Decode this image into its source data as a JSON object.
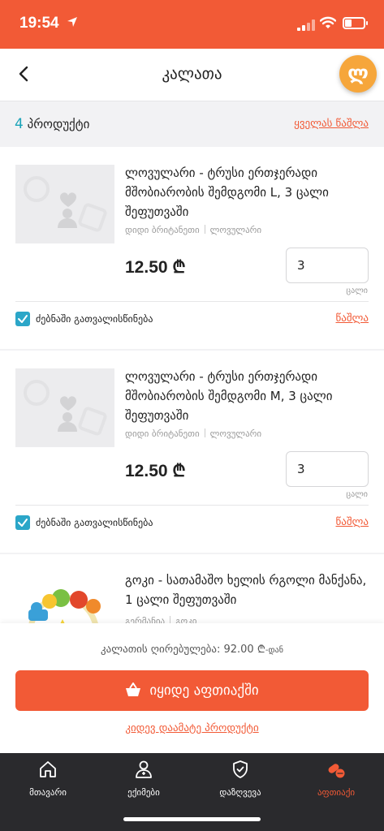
{
  "status_bar": {
    "time": "19:54"
  },
  "header": {
    "title": "კალათა",
    "fab_symbol": "ლ"
  },
  "cart": {
    "count_number": "4",
    "count_label": "პროდუქტი",
    "delete_all": "ყველას წაშლა"
  },
  "products": [
    {
      "name": "ლოვულარი - ტრუსი ერთჯერადი მშობიარობის შემდგომი L, 3 ცალი შეფუთვაში",
      "country": "დიდი ბრიტანეთი",
      "brand": "ლოვულარი",
      "price": "12.50 ₾",
      "quantity": "3",
      "unit": "ცალი",
      "option_label": "ძებნაში გათვალისწინება",
      "option_checked": true,
      "remove": "წაშლა"
    },
    {
      "name": "ლოვულარი - ტრუსი ერთჯერადი მშობიარობის შემდგომი M, 3 ცალი შეფუთვაში",
      "country": "დიდი ბრიტანეთი",
      "brand": "ლოვულარი",
      "price": "12.50 ₾",
      "quantity": "3",
      "unit": "ცალი",
      "option_label": "ძებნაში გათვალისწინება",
      "option_checked": true,
      "remove": "წაშლა"
    },
    {
      "name": "გოკი - სათამაშო ხელის რგოლი მანქანა, 1 ცალი შეფუთვაში",
      "country": "გერმანია",
      "brand": "გოკი"
    }
  ],
  "footer": {
    "total_label": "კალათის ღირებულება: 92.00 ₾",
    "total_suffix": "-დან",
    "buy_button": "იყიდე აფთიაქში",
    "add_more": "კიდევ დაამატე პროდუქტი"
  },
  "tabbar": {
    "items": [
      {
        "label": "მთავარი",
        "icon": "home-icon",
        "active": false
      },
      {
        "label": "ექიმები",
        "icon": "doctor-icon",
        "active": false
      },
      {
        "label": "დაზღვევა",
        "icon": "shield-icon",
        "active": false
      },
      {
        "label": "აფთიაქი",
        "icon": "pills-icon",
        "active": true
      }
    ]
  },
  "colors": {
    "accent": "#f25a36",
    "link_teal": "#1aa3b8",
    "checkbox": "#2ba6c8",
    "fab": "#f6a63b",
    "tabbar_bg": "#2a2a2d"
  }
}
